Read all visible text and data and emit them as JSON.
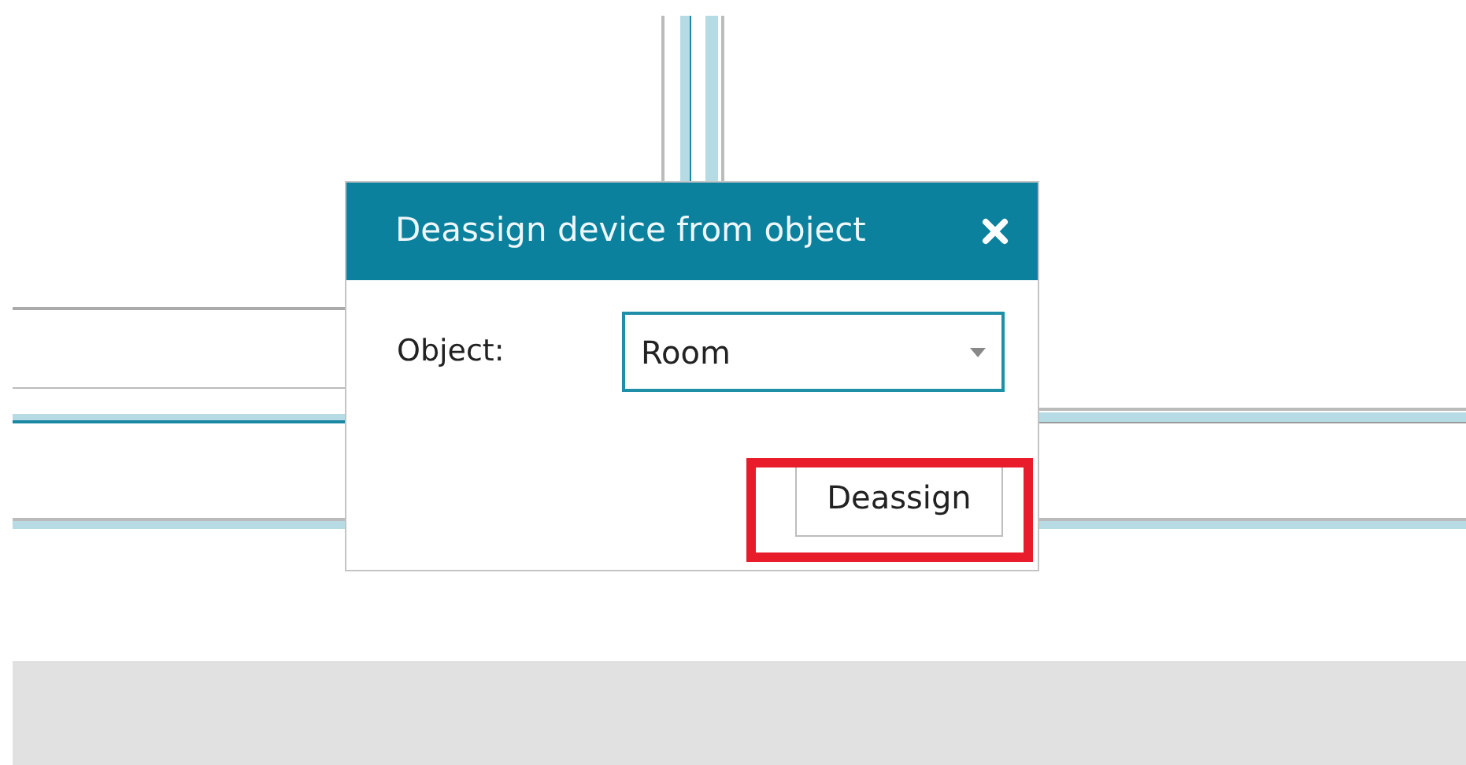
{
  "dialog": {
    "title": "Deassign device from object",
    "fields": [
      {
        "label": "Object:",
        "value": "Room"
      }
    ],
    "buttons": [
      {
        "label": "Deassign",
        "highlighted": true
      }
    ]
  }
}
